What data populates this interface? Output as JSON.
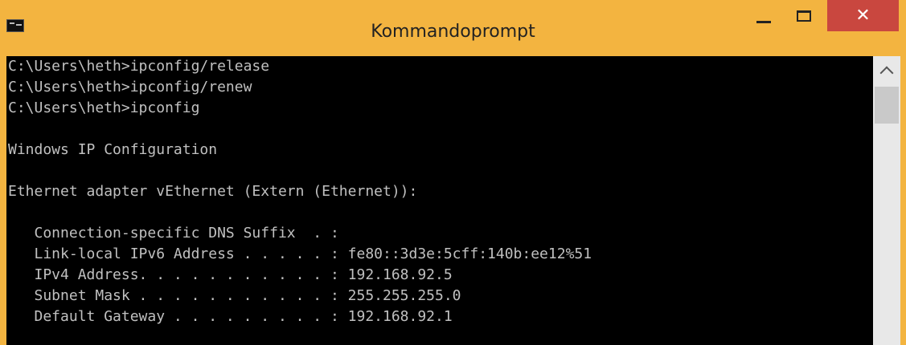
{
  "window": {
    "title": "Kommandoprompt",
    "accent_color": "#f3b440",
    "close_color": "#c9473f",
    "icons": {
      "app": "cmd-icon",
      "minimize": "minimize-icon",
      "maximize": "maximize-icon",
      "close": "close-icon"
    },
    "close_glyph": "✕"
  },
  "console": {
    "background": "#000000",
    "text_color": "#c0c0c0",
    "lines": [
      "C:\\Users\\heth>ipconfig/release",
      "C:\\Users\\heth>ipconfig/renew",
      "C:\\Users\\heth>ipconfig",
      "",
      "Windows IP Configuration",
      "",
      "Ethernet adapter vEthernet (Extern (Ethernet)):",
      "",
      "   Connection-specific DNS Suffix  . :",
      "   Link-local IPv6 Address . . . . . : fe80::3d3e:5cff:140b:ee12%51",
      "   IPv4 Address. . . . . . . . . . . : 192.168.92.5",
      "   Subnet Mask . . . . . . . . . . . : 255.255.255.0",
      "   Default Gateway . . . . . . . . . : 192.168.92.1"
    ]
  },
  "scrollbar": {
    "up_icon": "chevron-up-icon"
  }
}
